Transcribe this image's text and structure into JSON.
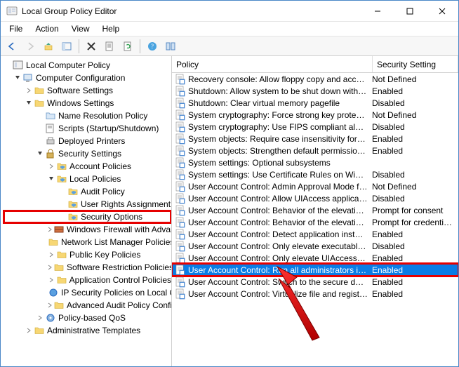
{
  "window": {
    "title": "Local Group Policy Editor"
  },
  "menu": {
    "file": "File",
    "action": "Action",
    "view": "View",
    "help": "Help"
  },
  "tree": {
    "root": "Local Computer Policy",
    "computer_config": "Computer Configuration",
    "software_settings": "Software Settings",
    "windows_settings": "Windows Settings",
    "name_resolution": "Name Resolution Policy",
    "scripts": "Scripts (Startup/Shutdown)",
    "deployed_printers": "Deployed Printers",
    "security_settings": "Security Settings",
    "account_policies": "Account Policies",
    "local_policies": "Local Policies",
    "audit_policy": "Audit Policy",
    "user_rights": "User Rights Assignment",
    "security_options": "Security Options",
    "windows_firewall": "Windows Firewall with Advanced Security",
    "network_list": "Network List Manager Policies",
    "public_key": "Public Key Policies",
    "software_restriction": "Software Restriction Policies",
    "app_control": "Application Control Policies",
    "ip_security": "IP Security Policies on Local Computer",
    "advanced_audit": "Advanced Audit Policy Configuration",
    "policy_qos": "Policy-based QoS",
    "admin_templates": "Administrative Templates"
  },
  "list": {
    "headers": {
      "policy": "Policy",
      "setting": "Security Setting"
    },
    "rows": [
      {
        "policy": "Recovery console: Allow floppy copy and access t...",
        "setting": "Not Defined"
      },
      {
        "policy": "Shutdown: Allow system to be shut down withou...",
        "setting": "Enabled"
      },
      {
        "policy": "Shutdown: Clear virtual memory pagefile",
        "setting": "Disabled"
      },
      {
        "policy": "System cryptography: Force strong key protectio...",
        "setting": "Not Defined"
      },
      {
        "policy": "System cryptography: Use FIPS compliant algorit...",
        "setting": "Disabled"
      },
      {
        "policy": "System objects: Require case insensitivity for non-...",
        "setting": "Enabled"
      },
      {
        "policy": "System objects: Strengthen default permissions o...",
        "setting": "Enabled"
      },
      {
        "policy": "System settings: Optional subsystems",
        "setting": ""
      },
      {
        "policy": "System settings: Use Certificate Rules on Window...",
        "setting": "Disabled"
      },
      {
        "policy": "User Account Control: Admin Approval Mode for...",
        "setting": "Not Defined"
      },
      {
        "policy": "User Account Control: Allow UIAccess application...",
        "setting": "Disabled"
      },
      {
        "policy": "User Account Control: Behavior of the elevation p...",
        "setting": "Prompt for consent"
      },
      {
        "policy": "User Account Control: Behavior of the elevation p...",
        "setting": "Prompt for credentials"
      },
      {
        "policy": "User Account Control: Detect application installat...",
        "setting": "Enabled"
      },
      {
        "policy": "User Account Control: Only elevate executables th...",
        "setting": "Disabled"
      },
      {
        "policy": "User Account Control: Only elevate UIAccess appl...",
        "setting": "Enabled"
      },
      {
        "policy": "User Account Control: Run all administrators in A...",
        "setting": "Enabled"
      },
      {
        "policy": "User Account Control: Switch to the secure deskt...",
        "setting": "Enabled"
      },
      {
        "policy": "User Account Control: Virtualize file and registry v...",
        "setting": "Enabled"
      }
    ],
    "selected_index": 16,
    "highlight_index": 16
  }
}
